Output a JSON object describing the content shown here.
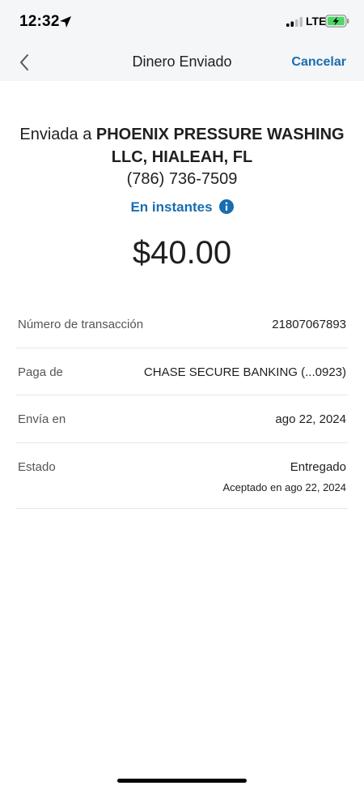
{
  "status_bar": {
    "time": "12:32",
    "network": "LTE",
    "icons": [
      "location-arrow-icon",
      "signal-icon",
      "battery-charging-icon"
    ],
    "battery_color": "#4cd964"
  },
  "nav": {
    "title": "Dinero Enviado",
    "cancel_label": "Cancelar",
    "back_icon": "chevron-left-icon"
  },
  "transfer": {
    "sent_to_prefix": "Enviada a ",
    "recipient_name": "PHOENIX PRESSURE WASHING LLC, HIALEAH, FL",
    "phone": "(786) 736-7509",
    "speed_label": "En instantes",
    "speed_icon": "info-icon",
    "amount": "$40.00"
  },
  "details": [
    {
      "label": "Número de transacción",
      "value": "21807067893"
    },
    {
      "label": "Paga de",
      "value": "CHASE SECURE BANKING (...0923)"
    },
    {
      "label": "Envía en",
      "value": "ago 22, 2024"
    },
    {
      "label": "Estado",
      "value": "Entregado",
      "sub": "Aceptado en ago 22, 2024"
    }
  ],
  "colors": {
    "accent": "#1a6db0",
    "header_bg": "#f5f6f7",
    "divider": "#e6e6e6"
  }
}
